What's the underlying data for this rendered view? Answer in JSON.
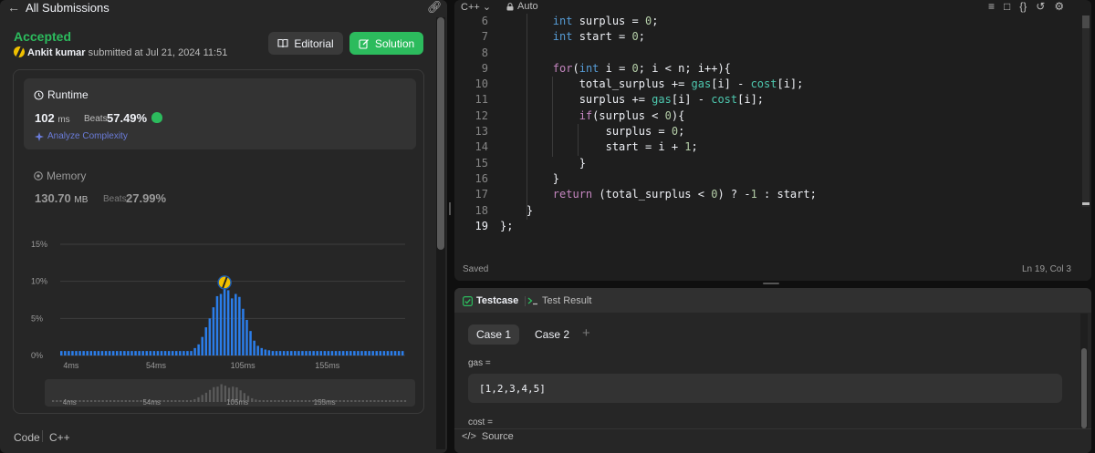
{
  "header": {
    "back_icon": "arrow-left-icon",
    "title": "All Submissions",
    "link_icon": "link-icon"
  },
  "submission": {
    "status": "Accepted",
    "user": "Ankit kumar",
    "submitted_text": "submitted at Jul 21, 2024 11:51",
    "editorial_label": "Editorial",
    "solution_label": "Solution",
    "status_color": "#2cbb5d"
  },
  "runtime": {
    "title": "Runtime",
    "value": "102",
    "unit": "ms",
    "beats_label": "Beats",
    "beats_value": "57.49%",
    "analyze_label": "Analyze Complexity"
  },
  "memory": {
    "title": "Memory",
    "value": "130.70",
    "unit": "MB",
    "beats_label": "Beats",
    "beats_value": "27.99%"
  },
  "chart_data": {
    "type": "bar",
    "y_ticks": [
      "15%",
      "10%",
      "5%",
      "0%"
    ],
    "x_ticks": [
      "4ms",
      "54ms",
      "105ms",
      "155ms"
    ],
    "ylim": [
      0,
      15
    ],
    "values": [
      0.6,
      0.6,
      0.6,
      0.6,
      0.6,
      0.6,
      0.6,
      0.6,
      0.6,
      0.6,
      0.6,
      0.6,
      0.6,
      0.6,
      0.6,
      0.6,
      0.6,
      0.6,
      0.6,
      0.6,
      0.6,
      0.6,
      0.6,
      0.6,
      0.6,
      0.6,
      0.6,
      0.6,
      0.6,
      0.6,
      0.6,
      0.6,
      0.6,
      0.6,
      0.6,
      0.6,
      1.0,
      1.5,
      2.5,
      3.8,
      5.0,
      6.5,
      8.0,
      8.3,
      9.6,
      8.8,
      7.7,
      8.3,
      7.9,
      6.3,
      4.8,
      3.3,
      2.0,
      1.3,
      1.0,
      0.8,
      0.7,
      0.6,
      0.6,
      0.6,
      0.6,
      0.6,
      0.6,
      0.6,
      0.6,
      0.6,
      0.6,
      0.6,
      0.6,
      0.6,
      0.6,
      0.6,
      0.6,
      0.6,
      0.6,
      0.6,
      0.6,
      0.6,
      0.6,
      0.6,
      0.6,
      0.6,
      0.6,
      0.6,
      0.6,
      0.6,
      0.6,
      0.6,
      0.6,
      0.6,
      0.6,
      0.6,
      0.6
    ],
    "highlight_index": 44,
    "bar_color": "#2b7de9",
    "marker_color": "#f0c000"
  },
  "footer": {
    "code_label": "Code",
    "language": "C++"
  },
  "editor": {
    "language": "C++",
    "mode": "Auto",
    "status": "Saved",
    "cursor": "Ln 19, Col 3",
    "toolbar_icons": [
      "format-icon",
      "bookmark-icon",
      "braces-icon",
      "reset-icon",
      "settings-icon"
    ],
    "lines": [
      {
        "n": "6",
        "code": "        int surplus = 0;"
      },
      {
        "n": "7",
        "code": "        int start = 0;"
      },
      {
        "n": "8",
        "code": ""
      },
      {
        "n": "9",
        "code": "        for(int i = 0; i < n; i++){"
      },
      {
        "n": "10",
        "code": "            total_surplus += gas[i] - cost[i];"
      },
      {
        "n": "11",
        "code": "            surplus += gas[i] - cost[i];"
      },
      {
        "n": "12",
        "code": "            if(surplus < 0){"
      },
      {
        "n": "13",
        "code": "                surplus = 0;"
      },
      {
        "n": "14",
        "code": "                start = i + 1;"
      },
      {
        "n": "15",
        "code": "            }"
      },
      {
        "n": "16",
        "code": "        }"
      },
      {
        "n": "17",
        "code": "        return (total_surplus < 0) ? -1 : start;"
      },
      {
        "n": "18",
        "code": "    }"
      },
      {
        "n": "19",
        "code": "};"
      }
    ]
  },
  "testcase": {
    "tab_testcase": "Testcase",
    "tab_result": "Test Result",
    "case1": "Case 1",
    "case2": "Case 2",
    "add": "+",
    "gas_label": "gas =",
    "gas_value": "[1,2,3,4,5]",
    "cost_label": "cost =",
    "source_label": "Source"
  }
}
